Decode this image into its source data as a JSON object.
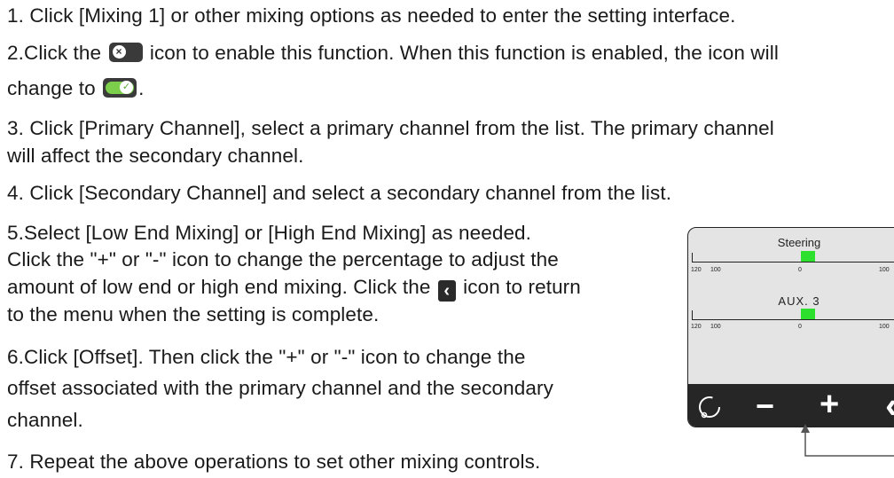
{
  "instructions": {
    "line1": "1. Click [Mixing 1] or other mixing options as needed to enter the setting interface.",
    "line2_a": "2.Click the",
    "line2_b": "icon to enable this function. When this function is enabled, the icon will",
    "line3_a": "change to",
    "line3_b": ".",
    "line4": "3. Click [Primary Channel], select a primary channel from the list. The primary channel",
    "line5": "will affect the secondary channel.",
    "line6": "4. Click [Secondary Channel] and select a secondary channel from the list.",
    "line7": "5.Select [Low End Mixing] or [High End Mixing] as needed.",
    "line8": "Click the \"+\" or \"-\" icon to change the percentage to adjust the",
    "line9_a": "amount of low end or high end mixing. Click the",
    "line9_b": "icon to return",
    "line10": "to the menu when the setting is complete.",
    "line11": "6.Click [Offset]. Then click the \"+\" or \"-\" icon to change the",
    "line12": "offset associated with the primary channel and the secondary",
    "line13": "channel.",
    "line14": "7. Repeat the above operations to set other mixing controls."
  },
  "icons": {
    "toggle_off": "toggle-off-icon",
    "toggle_on": "toggle-on-icon",
    "back": "back-chevron-icon"
  },
  "device": {
    "bar1_title": "Steering",
    "bar2_title": "AUX. 3",
    "tick_left_outer": "120",
    "tick_left_inner": "100",
    "tick_center": "0",
    "tick_right": "100",
    "btn_minus": "−",
    "btn_plus": "+",
    "btn_back": "‹"
  },
  "colors": {
    "bar_fill": "#2ee02e",
    "screen_bg": "#e4e4e4",
    "button_bar": "#262626",
    "toggle_on_green": "#7ccf4a"
  }
}
